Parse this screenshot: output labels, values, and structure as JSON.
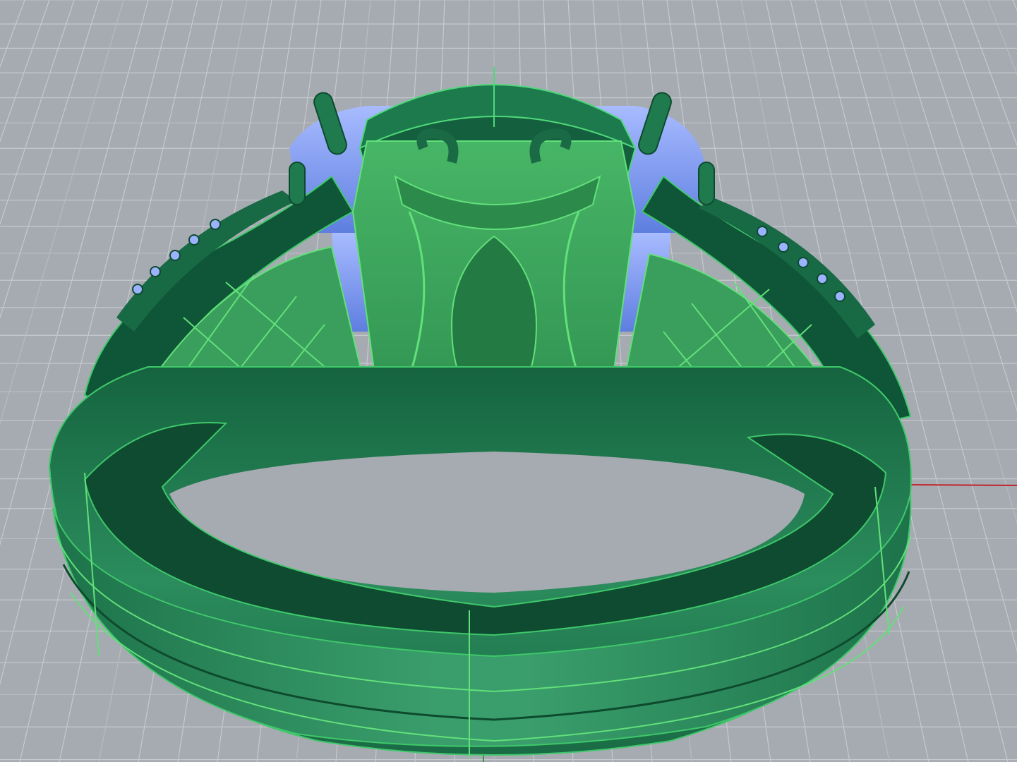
{
  "viewport": {
    "label": "",
    "display_mode": "shaded",
    "background_color": "#a6abb1",
    "grid_line_color": "#c6cacf",
    "grid_major_color": "#b8bcc1",
    "x_axis_color": "#c2232a",
    "y_axis_color": "#2f9a3a"
  },
  "model": {
    "object": "ring",
    "body_color": "#1f7a4e",
    "body_dark_color": "#0f4f33",
    "body_light_color": "#2e8f5e",
    "selected_face_color": "#3fae5b",
    "edge_color": "#62e07a",
    "gem_color": "#7f9bf0",
    "gem_highlight_color": "#b5c5ff"
  }
}
